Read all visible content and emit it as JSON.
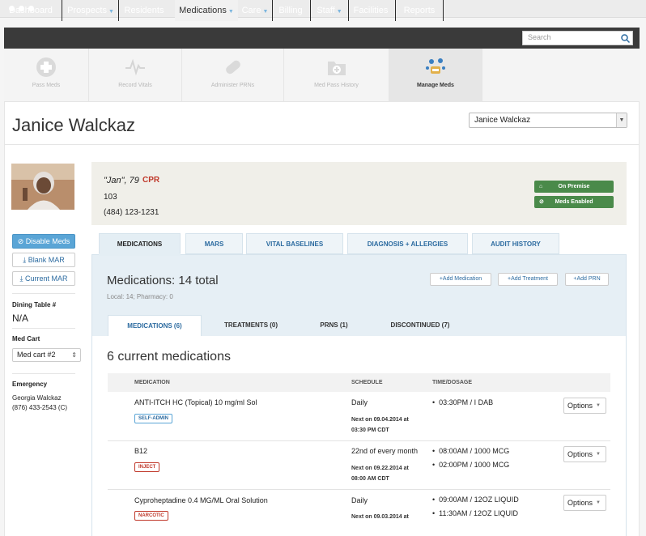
{
  "nav": {
    "items": [
      {
        "label": "Dashboard"
      },
      {
        "label": "Prospects",
        "dropdown": true
      },
      {
        "label": "Residents"
      },
      {
        "label": "Medications",
        "dropdown": true,
        "active": true
      },
      {
        "label": "Care",
        "dropdown": true
      },
      {
        "label": "Billing"
      },
      {
        "label": "Staff",
        "dropdown": true
      },
      {
        "label": "Facilities"
      },
      {
        "label": "Reports"
      }
    ],
    "search_placeholder": "Search"
  },
  "quickbar": [
    {
      "label": "Pass Meds",
      "icon": "pill-box-icon"
    },
    {
      "label": "Record Vitals",
      "icon": "heartbeat-icon"
    },
    {
      "label": "Administer PRNs",
      "icon": "capsule-icon"
    },
    {
      "label": "Med Pass History",
      "icon": "folder-plus-icon"
    },
    {
      "label": "Manage Meds",
      "icon": "manage-meds-icon",
      "active": true
    }
  ],
  "resident": {
    "name": "Janice Walckaz",
    "select_value": "Janice Walckaz",
    "nickname_age": "\"Jan\", 79",
    "cpr": "CPR",
    "room": "103",
    "phone": "(484) 123-1231",
    "badges": [
      "On Premise",
      "Meds Enabled"
    ]
  },
  "sidebar": {
    "buttons": [
      "Disable Meds",
      "Blank MAR",
      "Current MAR"
    ],
    "dining_label": "Dining Table #",
    "dining_value": "N/A",
    "medcart_label": "Med Cart",
    "medcart_value": "Med cart #2",
    "emergency_label": "Emergency",
    "emergency_name": "Georgia Walckaz",
    "emergency_phone": "(876) 433-2543 (C)"
  },
  "tabs": [
    "MEDICATIONS",
    "MARS",
    "VITAL BASELINES",
    "DIAGNOSIS + ALLERGIES",
    "AUDIT HISTORY"
  ],
  "meds": {
    "title": "Medications: 14 total",
    "subtitle": "Local: 14; Pharmacy: 0",
    "actions": [
      "Add Medication",
      "Add Treatment",
      "Add PRN"
    ],
    "subtabs": [
      "MEDICATIONS (6)",
      "TREATMENTS (0)",
      "PRNS (1)",
      "DISCONTINUED (7)"
    ],
    "current_title": "6 current medications",
    "columns": [
      "MEDICATION",
      "SCHEDULE",
      "TIME/DOSAGE"
    ],
    "rows": [
      {
        "name": "ANTI-ITCH HC (Topical) 10 mg/ml Sol",
        "tag": "SELF-ADMIN",
        "tag_color": "blue",
        "schedule": "Daily",
        "next1": "Next on 09.04.2014 at",
        "next2": "03:30 PM CDT",
        "times": [
          "03:30PM / I DAB"
        ],
        "options": "Options"
      },
      {
        "name": "B12",
        "tag": "INJECT",
        "tag_color": "red",
        "schedule": "22nd of every month",
        "next1": "Next on 09.22.2014 at",
        "next2": "08:00 AM CDT",
        "times": [
          "08:00AM / 1000 MCG",
          "02:00PM / 1000 MCG"
        ],
        "options": "Options"
      },
      {
        "name": "Cyproheptadine 0.4 MG/ML Oral Solution",
        "tag": "NARCOTIC",
        "tag_color": "red",
        "schedule": "Daily",
        "next1": "Next on 09.03.2014 at",
        "next2": "",
        "times": [
          "09:00AM / 12OZ LIQUID",
          "11:30AM / 12OZ LIQUID"
        ],
        "options": "Options"
      }
    ]
  }
}
